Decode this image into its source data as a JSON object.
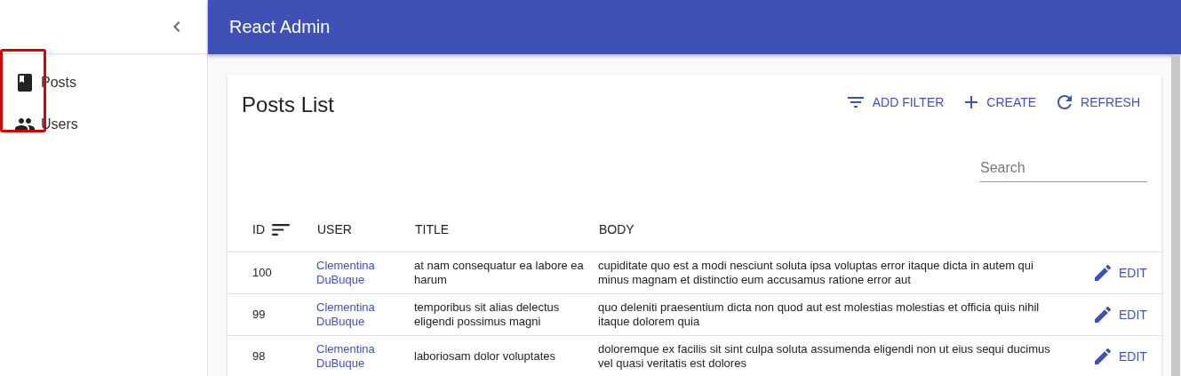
{
  "app_bar": {
    "title": "React Admin"
  },
  "sidebar": {
    "items": [
      {
        "label": "Posts",
        "selected": false
      },
      {
        "label": "Users",
        "selected": false
      }
    ]
  },
  "list": {
    "title": "Posts List",
    "actions": [
      {
        "label": "ADD FILTER"
      },
      {
        "label": "CREATE"
      },
      {
        "label": "REFRESH"
      }
    ],
    "search": {
      "placeholder": "Search"
    },
    "columns": [
      {
        "label": "ID",
        "sorted": true
      },
      {
        "label": "USER",
        "sorted": false
      },
      {
        "label": "TITLE",
        "sorted": false
      },
      {
        "label": "BODY",
        "sorted": false
      }
    ],
    "rows": [
      {
        "id": "100",
        "user": "Clementina DuBuque",
        "title": "at nam consequatur ea labore ea harum",
        "body": "cupiditate quo est a modi nesciunt soluta ipsa voluptas error itaque dicta in autem qui minus magnam et distinctio eum accusamus ratione error aut",
        "action": "EDIT"
      },
      {
        "id": "99",
        "user": "Clementina DuBuque",
        "title": "temporibus sit alias delectus eligendi possimus magni",
        "body": "quo deleniti praesentium dicta non quod aut est molestias molestias et officia quis nihil itaque dolorem quia",
        "action": "EDIT"
      },
      {
        "id": "98",
        "user": "Clementina DuBuque",
        "title": "laboriosam dolor voluptates",
        "body": "doloremque ex facilis sit sint culpa soluta assumenda eligendi non ut eius sequi ducimus vel quasi veritatis est dolores",
        "action": "EDIT"
      }
    ]
  }
}
